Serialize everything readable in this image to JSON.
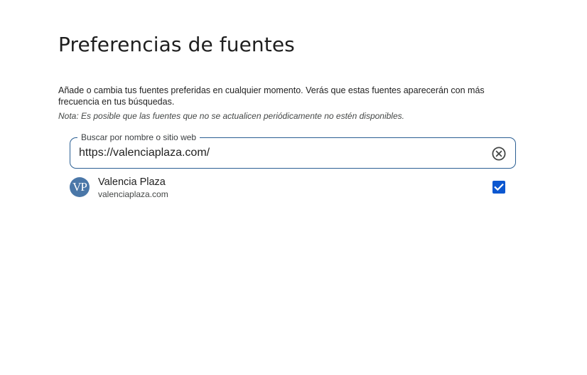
{
  "page": {
    "title": "Preferencias de fuentes",
    "description": "Añade o cambia tus fuentes preferidas en cualquier momento. Verás que estas fuentes aparecerán con más frecuencia en tus búsquedas.",
    "note": "Nota: Es posible que las fuentes que no se actualicen periódicamente no estén disponibles."
  },
  "search": {
    "label": "Buscar por nombre o sitio web",
    "value": "https://valenciaplaza.com/",
    "clear_icon": "clear-circle-icon"
  },
  "results": [
    {
      "logo_text": "VP",
      "name": "Valencia Plaza",
      "domain": "valenciaplaza.com",
      "checked": true
    }
  ],
  "colors": {
    "accent": "#0b57d0",
    "field_border": "#2b5f93",
    "logo_bg": "#4a77a8"
  }
}
